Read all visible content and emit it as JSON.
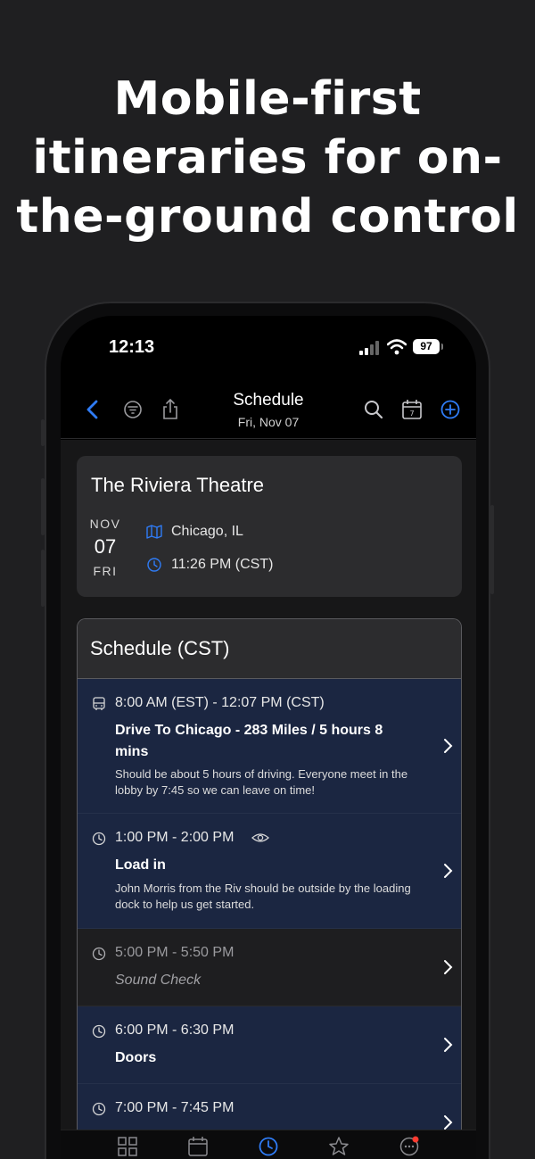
{
  "headline": {
    "line1": "Mobile-first",
    "line2": "itineraries for on-",
    "line3": "the-ground control"
  },
  "status_bar": {
    "time": "12:13",
    "battery": "97"
  },
  "nav": {
    "title": "Schedule",
    "subtitle": "Fri, Nov 07"
  },
  "venue": {
    "name": "The Riviera Theatre",
    "month": "NOV",
    "day": "07",
    "weekday": "FRI",
    "location": "Chicago, IL",
    "time": "11:26 PM (CST)"
  },
  "schedule": {
    "header": "Schedule (CST)",
    "items": [
      {
        "time": "8:00 AM (EST) - 12:07 PM (CST)",
        "title": "Drive To Chicago - 283 Miles / 5 hours 8 mins",
        "description": "Should be about 5 hours of driving. Everyone meet in the lobby by 7:45 so we can leave on time!",
        "icon": "bus-icon"
      },
      {
        "time": "1:00 PM - 2:00 PM",
        "title": "Load in",
        "description": "John Morris from the Riv should be outside by the loading dock to help us get started.",
        "icon": "clock-icon"
      },
      {
        "time": "5:00 PM - 5:50 PM",
        "title": "Sound Check",
        "description": "",
        "icon": "clock-icon"
      },
      {
        "time": "6:00 PM - 6:30 PM",
        "title": "Doors",
        "description": "",
        "icon": "clock-icon"
      },
      {
        "time": "7:00 PM - 7:45 PM",
        "title": "",
        "description": "",
        "icon": "clock-icon"
      }
    ]
  },
  "colors": {
    "accent": "#2f7cf6",
    "item_blue_bg": "#1b2641",
    "card_bg": "#2c2c2e",
    "notification_dot": "#ff3b30"
  }
}
